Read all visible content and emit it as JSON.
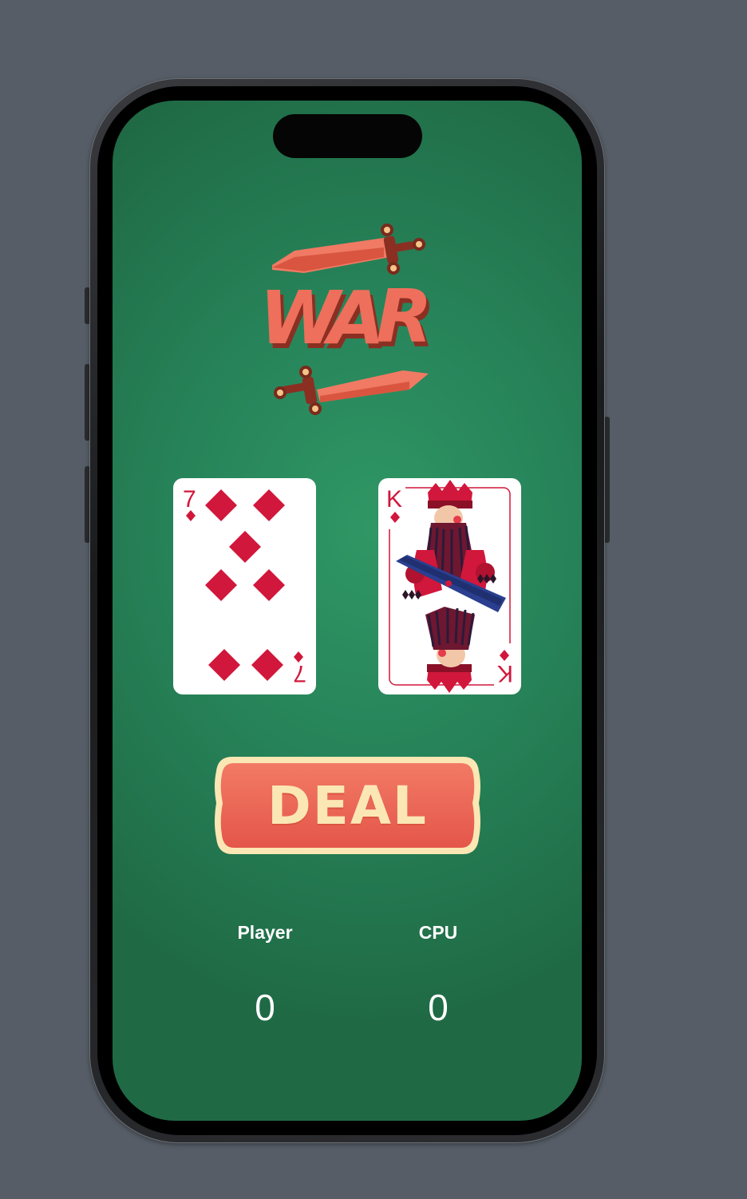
{
  "app": {
    "logo_text": "WAR",
    "deal_label": "DEAL"
  },
  "cards": {
    "player": {
      "rank": "7",
      "suit": "diamonds",
      "suit_icon": "diamond-icon"
    },
    "cpu": {
      "rank": "K",
      "suit": "diamonds",
      "suit_icon": "diamond-icon",
      "face": "king"
    }
  },
  "scores": {
    "player": {
      "label": "Player",
      "value": "0"
    },
    "cpu": {
      "label": "CPU",
      "value": "0"
    }
  },
  "colors": {
    "table_green": "#2f9764",
    "card_red": "#d1173b",
    "button_red": "#ec6552",
    "button_cream": "#fbe7b4",
    "bezel": "#565d66"
  }
}
